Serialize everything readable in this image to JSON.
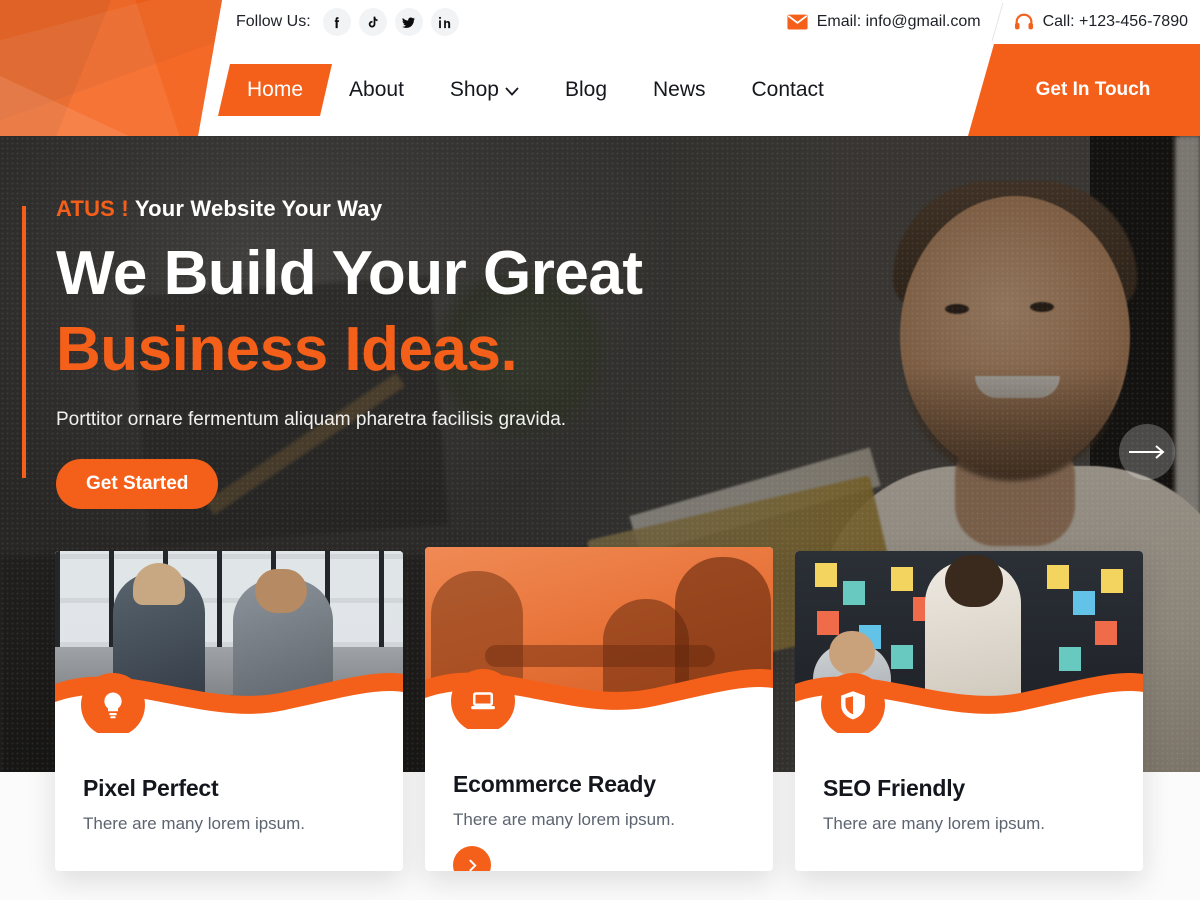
{
  "brand": {
    "name": "ATUS",
    "accent_color": "#f4601a",
    "logo_icon": "atus-logo-mark"
  },
  "topbar": {
    "follow_label": "Follow Us:",
    "socials": [
      {
        "name": "facebook",
        "icon": "facebook-icon"
      },
      {
        "name": "tiktok",
        "icon": "tiktok-icon"
      },
      {
        "name": "twitter",
        "icon": "twitter-icon"
      },
      {
        "name": "linkedin",
        "icon": "linkedin-icon"
      }
    ],
    "email": {
      "icon": "envelope-icon",
      "text": "Email: info@gmail.com"
    },
    "phone": {
      "icon": "headset-icon",
      "text": "Call: +123-456-7890"
    }
  },
  "nav": {
    "items": [
      {
        "label": "Home",
        "active": true,
        "has_dropdown": false
      },
      {
        "label": "About",
        "active": false,
        "has_dropdown": false
      },
      {
        "label": "Shop",
        "active": false,
        "has_dropdown": true
      },
      {
        "label": "Blog",
        "active": false,
        "has_dropdown": false
      },
      {
        "label": "News",
        "active": false,
        "has_dropdown": false
      },
      {
        "label": "Contact",
        "active": false,
        "has_dropdown": false
      }
    ],
    "dropdown_caret": "⌄",
    "cart_icon": "shopping-cart-icon",
    "search_icon": "search-icon",
    "cta_label": "Get In Touch"
  },
  "hero": {
    "eyebrow_brand": "ATUS !",
    "eyebrow_rest": "Your Website Your Way",
    "title_line1": "We Build Your Great",
    "title_line2": "Business Ideas.",
    "subtitle": "Porttitor ornare fermentum aliquam pharetra facilisis gravida.",
    "button_label": "Get Started",
    "next_arrow_icon": "arrow-right-icon"
  },
  "feature_cards": [
    {
      "title": "Pixel Perfect",
      "description": "There are many lorem ipsum.",
      "icon": "lightbulb-icon",
      "has_more_button": false,
      "more_icon": "chevron-right-icon"
    },
    {
      "title": "Ecommerce Ready",
      "description": "There are many lorem ipsum.",
      "icon": "laptop-icon",
      "has_more_button": true,
      "more_icon": "chevron-right-icon"
    },
    {
      "title": "SEO Friendly",
      "description": "There are many lorem ipsum.",
      "icon": "shield-icon",
      "has_more_button": false,
      "more_icon": "chevron-right-icon"
    }
  ]
}
